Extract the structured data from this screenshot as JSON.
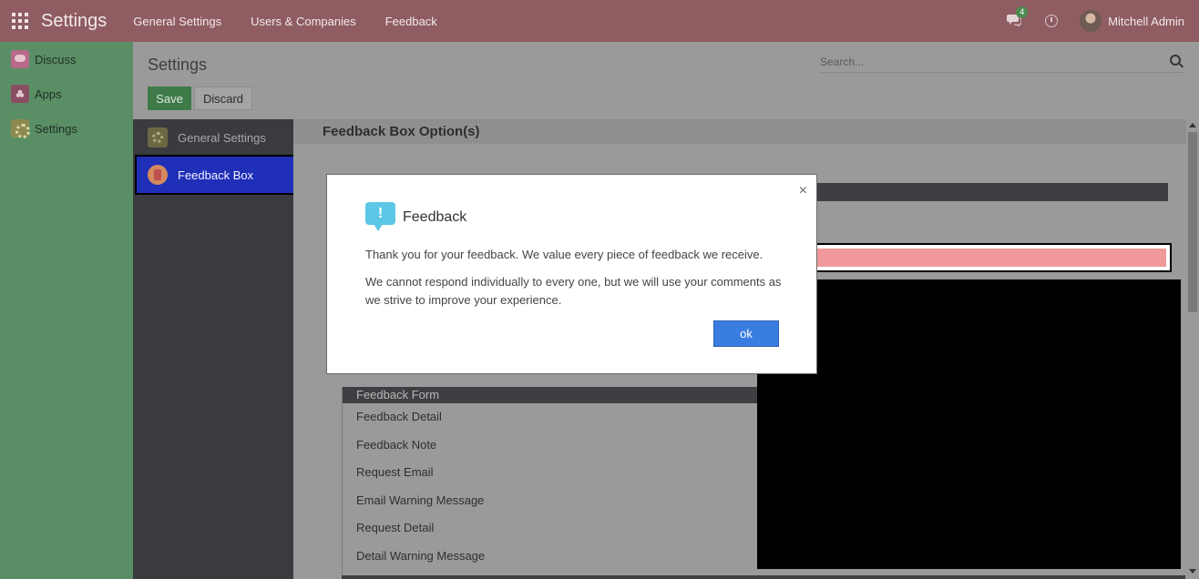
{
  "navbar": {
    "brand": "Settings",
    "menu": [
      "General Settings",
      "Users & Companies",
      "Feedback"
    ],
    "message_count": "4",
    "user_name": "Mitchell Admin"
  },
  "app_sidebar": {
    "items": [
      {
        "label": "Discuss",
        "icon": "discuss-icon"
      },
      {
        "label": "Apps",
        "icon": "apps-icon"
      },
      {
        "label": "Settings",
        "icon": "settings-icon"
      }
    ]
  },
  "control_panel": {
    "title": "Settings",
    "search_placeholder": "Search...",
    "save_label": "Save",
    "discard_label": "Discard"
  },
  "settings_sidebar": {
    "items": [
      {
        "label": "General Settings",
        "active": false
      },
      {
        "label": "Feedback Box",
        "active": true
      }
    ]
  },
  "content": {
    "section_title": "Feedback Box Option(s)",
    "form_header": "Feedback Form",
    "form_rows": [
      "Feedback Detail",
      "Feedback Note",
      "Request Email",
      "Email Warning Message",
      "Request Detail",
      "Detail Warning Message"
    ]
  },
  "modal": {
    "title": "Feedback",
    "close": "×",
    "icon_symbol": "!",
    "paragraph_1": "Thank you for your feedback. We value every piece of feedback we receive.",
    "paragraph_2": "We cannot respond individually to every one, but we will use your comments as we strive to improve your experience.",
    "ok_label": "ok"
  },
  "colors": {
    "navbar": "#8e5c61",
    "sidebar": "#5a8f66",
    "active_item": "#1f2fb8",
    "ok_button": "#3a7de0",
    "alert_field": "#f1999a"
  }
}
